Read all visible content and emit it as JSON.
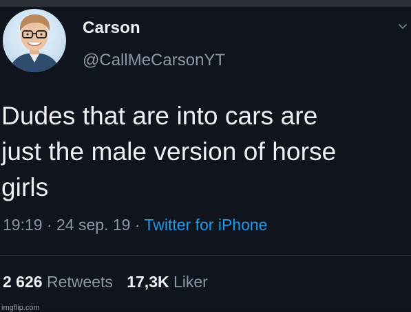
{
  "tweet": {
    "display_name": "Carson",
    "handle": "@CallMeCarsonYT",
    "text_lines": [
      "Dudes that are into cars are",
      "just the male version of horse",
      "girls"
    ],
    "time": "19:19",
    "date": "24 sep. 19",
    "separator": "·",
    "source": "Twitter for iPhone"
  },
  "stats": {
    "retweets_count": "2 626",
    "retweets_label": "Retweets",
    "likes_count": "17,3K",
    "likes_label": "Liker"
  },
  "watermark": "imgflip.com",
  "icons": {
    "avatar": "profile-photo",
    "menu": "chevron-down-icon"
  },
  "colors": {
    "background": "#10151d",
    "accent": "#1d9bf0",
    "muted_text": "#8b98a5",
    "primary_text": "#eef1f4"
  }
}
